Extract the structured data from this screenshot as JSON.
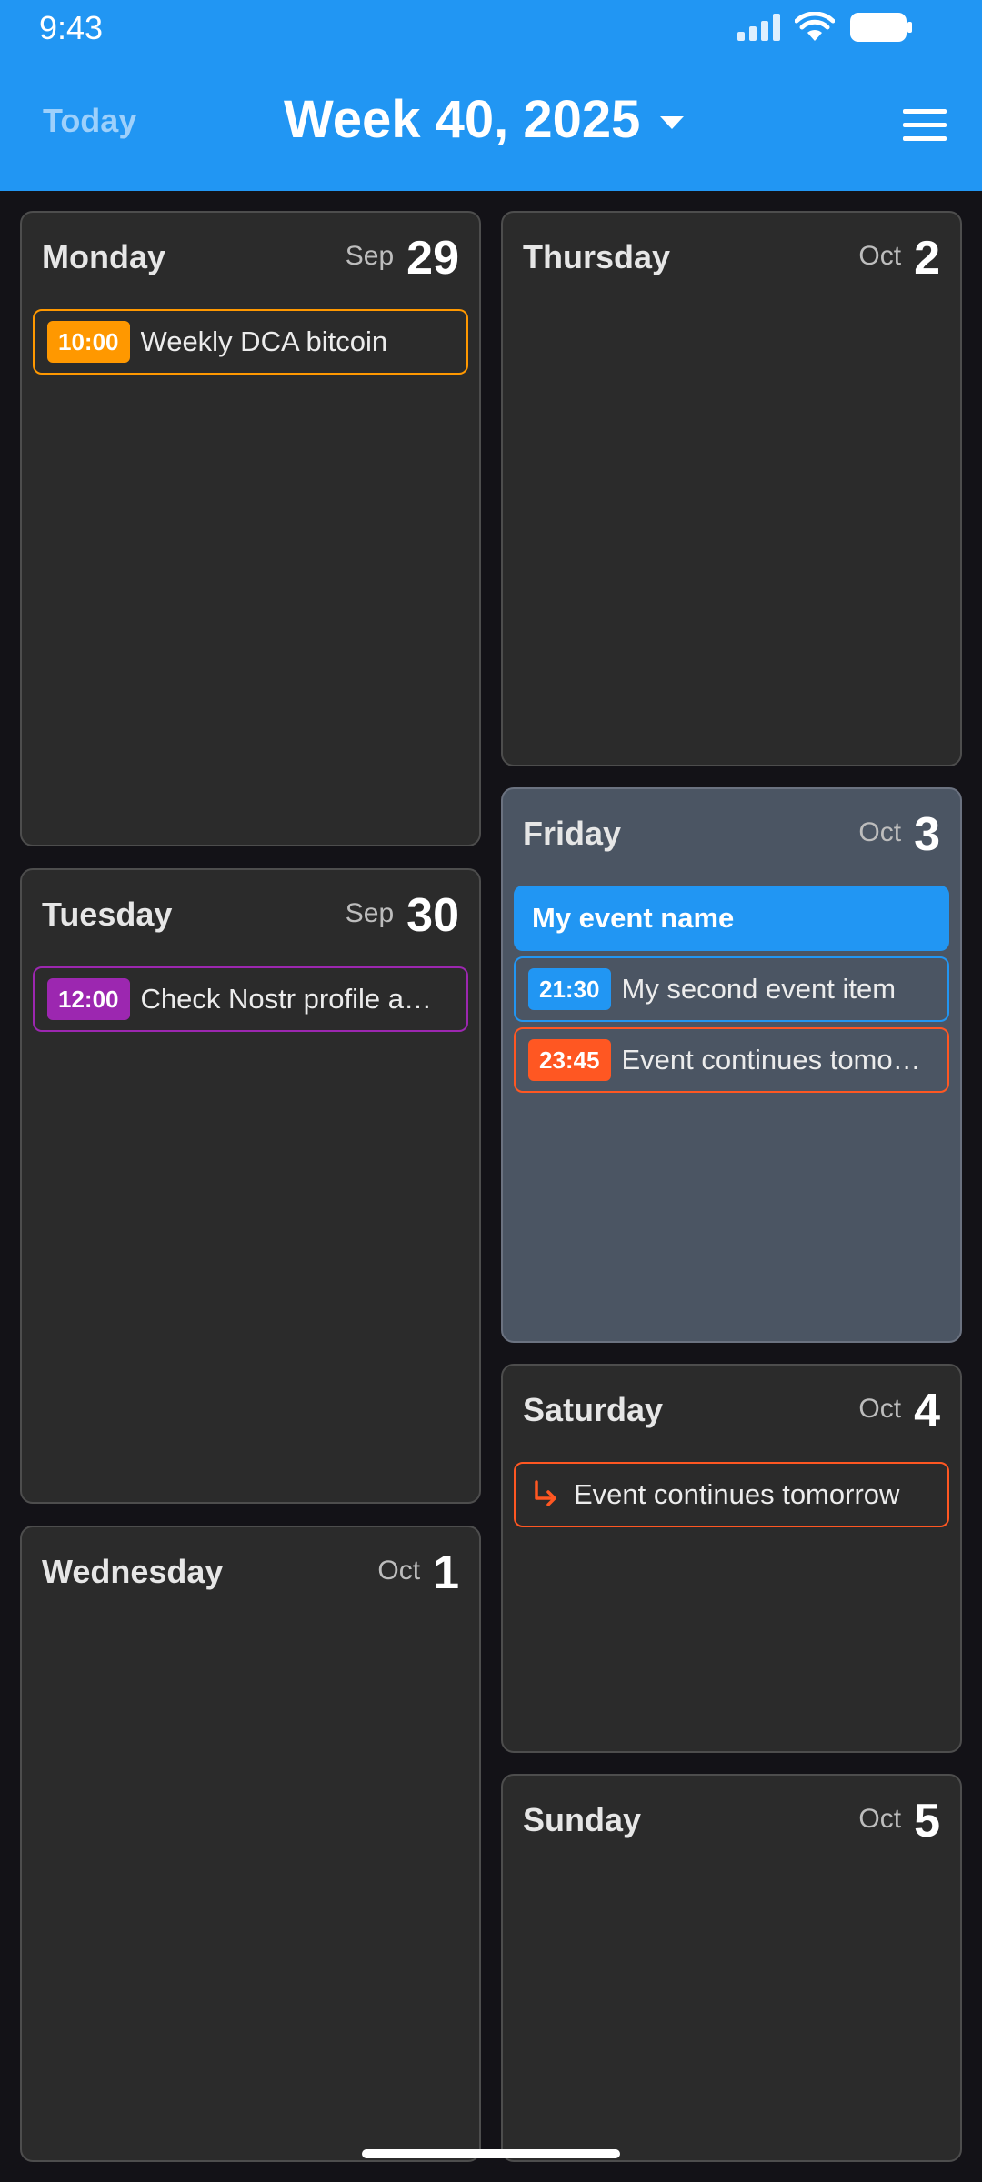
{
  "status_bar": {
    "time": "9:43"
  },
  "app_bar": {
    "today_label": "Today",
    "week_title": "Week 40, 2025"
  },
  "colors": {
    "app_bar": "#2196f3",
    "orange": "#ff9800",
    "purple": "#9c27b0",
    "blue": "#2196f3",
    "deep_orange": "#ff5722"
  },
  "days": [
    {
      "name": "Monday",
      "month": "Sep",
      "day": "29",
      "events": [
        {
          "time": "10:00",
          "title": "Weekly DCA bitcoin",
          "color": "#ff9800"
        }
      ]
    },
    {
      "name": "Tuesday",
      "month": "Sep",
      "day": "30",
      "events": [
        {
          "time": "12:00",
          "title": "Check Nostr profile a…",
          "color": "#9c27b0"
        }
      ]
    },
    {
      "name": "Wednesday",
      "month": "Oct",
      "day": "1",
      "events": []
    },
    {
      "name": "Thursday",
      "month": "Oct",
      "day": "2",
      "events": []
    },
    {
      "name": "Friday",
      "month": "Oct",
      "day": "3",
      "events": [
        {
          "title": "My event name",
          "color": "#2196f3",
          "style": "all-day"
        },
        {
          "time": "21:30",
          "title": "My second event item",
          "color": "#2196f3"
        },
        {
          "time": "23:45",
          "title": "Event continues tomo…",
          "color": "#ff5722"
        }
      ]
    },
    {
      "name": "Saturday",
      "month": "Oct",
      "day": "4",
      "events": [
        {
          "title": "Event continues tomorrow",
          "color": "#ff5722",
          "icon": "continuation-arrow-icon"
        }
      ]
    },
    {
      "name": "Sunday",
      "month": "Oct",
      "day": "5",
      "events": []
    }
  ]
}
